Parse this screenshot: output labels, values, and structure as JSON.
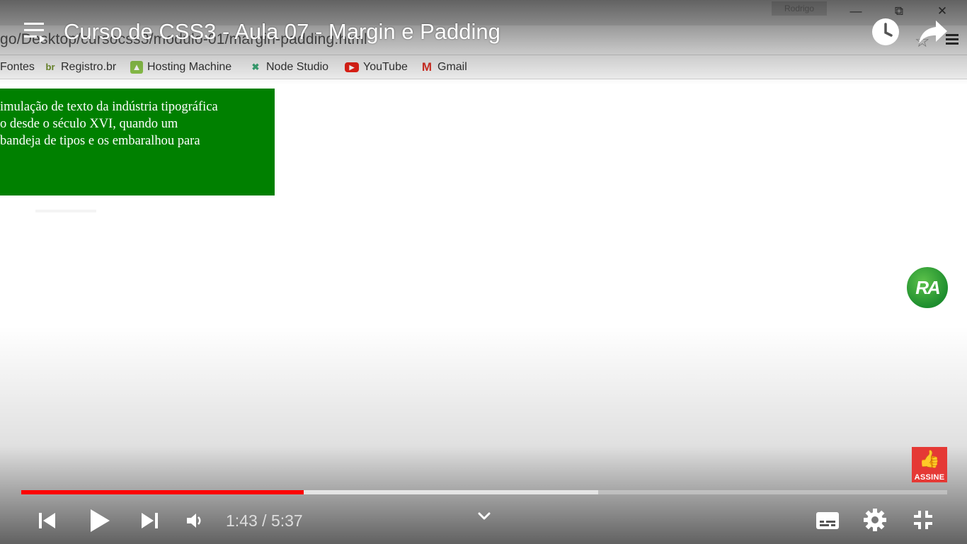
{
  "player": {
    "title": "Curso de CSS3 - Aula 07 - Margin e Padding",
    "time_current": "1:43",
    "time_separator": " / ",
    "time_total": "5:37",
    "progress_played": 0.305,
    "progress_buffered": 0.623,
    "accent_color": "#ff0000",
    "subscribe_label": "ASSINE",
    "channel_watermark": "RA",
    "icons": {
      "playlist": "playlist-icon",
      "watch_later": "clock-icon",
      "share": "share-arrow-icon",
      "previous": "skip-previous-icon",
      "play": "play-icon",
      "next": "skip-next-icon",
      "volume": "volume-icon",
      "expand": "chevron-down-icon",
      "subtitles": "subtitles-icon",
      "settings": "gear-icon",
      "exit_fullscreen": "exit-fullscreen-icon"
    }
  },
  "video_content": {
    "window_user": "Rodrigo",
    "url": "go/Desktop/cursocss3/modulo-01/margin-padding.html",
    "bookmarks": [
      {
        "label": "Fontes",
        "icon": "folder-icon"
      },
      {
        "label": "Registro.br",
        "icon": "registro-br-icon"
      },
      {
        "label": "Hosting Machine",
        "icon": "hosting-machine-icon"
      },
      {
        "label": "Node Studio",
        "icon": "node-studio-icon"
      },
      {
        "label": "YouTube",
        "icon": "youtube-icon"
      },
      {
        "label": "Gmail",
        "icon": "gmail-icon"
      }
    ],
    "green_box_color": "#008000",
    "green_box_lines": [
      "imulação de texto da indústria tipográfica",
      "o desde o século XVI, quando um",
      "bandeja de tipos e os embaralhou para"
    ]
  }
}
